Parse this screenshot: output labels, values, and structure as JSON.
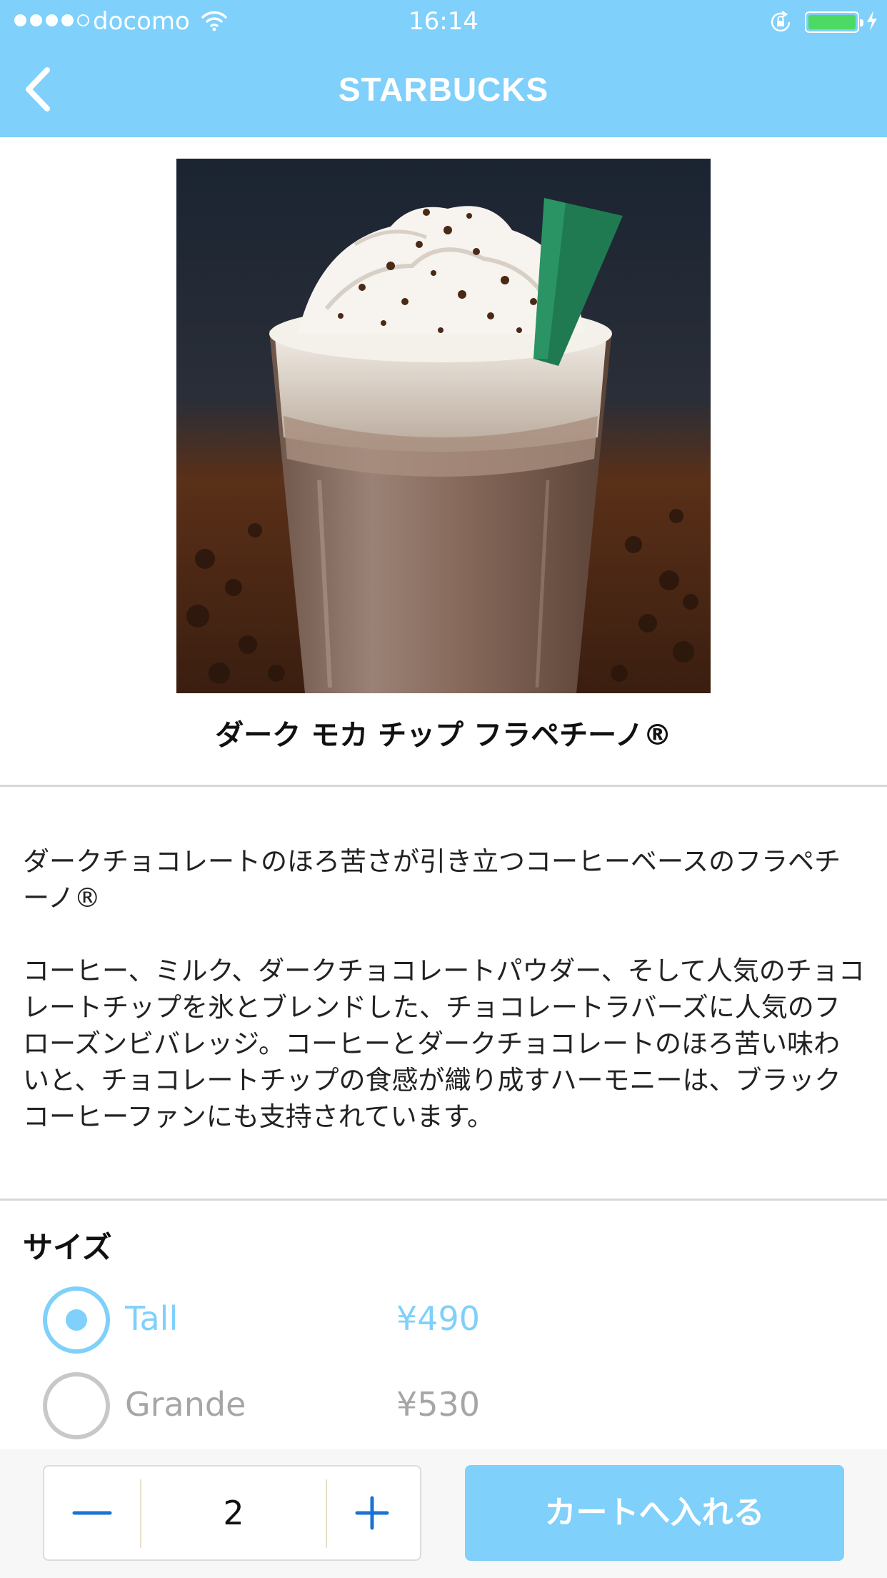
{
  "status_bar": {
    "carrier": "docomo",
    "time": "16:14",
    "signal_bars": 4,
    "signal_max": 5,
    "battery_level": 1.0,
    "charging": true
  },
  "nav": {
    "title": "STARBUCKS",
    "back_icon": "chevron-left-icon"
  },
  "product": {
    "name": "ダーク モカ チップ フラペチーノ®",
    "image": "frappuccino-photo",
    "description": [
      "ダークチョコレートのほろ苦さが引き立つコーヒーベースのフラペチーノ®",
      "コーヒー、ミルク、ダークチョコレートパウダー、そして人気のチョコレートチップを氷とブレンドした、チョコレートラバーズに人気のフローズンビバレッジ。コーヒーとダークチョコレートのほろ苦い味わいと、チョコレートチップの食感が織り成すハーモニーは、ブラックコーヒーファンにも支持されています。"
    ]
  },
  "size": {
    "label": "サイズ",
    "options": [
      {
        "name": "Tall",
        "price": "¥490",
        "selected": true
      },
      {
        "name": "Grande",
        "price": "¥530",
        "selected": false
      }
    ]
  },
  "cart": {
    "quantity": "2",
    "minus_icon": "minus-icon",
    "plus_icon": "plus-icon",
    "button_label": "カートへ入れる"
  },
  "colors": {
    "accent": "#7fd0fa",
    "battery": "#4cd964",
    "inactive": "#a6a6a6"
  }
}
